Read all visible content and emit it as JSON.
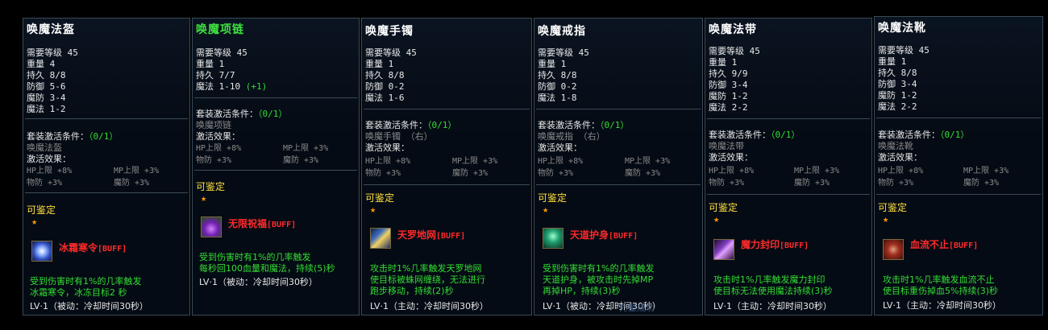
{
  "cards": [
    {
      "title": "唤魔法盔",
      "stats": [
        "需要等级 45",
        "重量 4",
        "持久 8/8",
        "防御 5-6",
        "魔防 3-4",
        "魔法 1-2"
      ],
      "set_label": "套装激活条件：",
      "set_count": "（0/1）",
      "set_item": "唤魔法盔",
      "set_item_suffix": "",
      "effect_label": "激活效果：",
      "eff_hp": "HP上限 +8%",
      "eff_mp": "MP上限 +3%",
      "eff_wf": "物防 +3%",
      "eff_mf": "魔防 +3%",
      "identify": "可鉴定",
      "skill_name": "冰霜寒令",
      "skill_tag": "[BUFF]",
      "desc": [
        "受到伤害时有1%的几率触发",
        "冰霜寒令，冰冻目标2 秒"
      ],
      "lv": "LV·1（被动：冷却时间30秒）",
      "icon": "ice-swirl-icon"
    },
    {
      "title": "唤魔项链",
      "stats": [
        "需要等级 45",
        "重量 1",
        "持久 7/7",
        "魔法 1-10"
      ],
      "stat_bonus": "(+1)",
      "set_label": "套装激活条件：",
      "set_count": "（0/1）",
      "set_item": "唤魔项链",
      "set_item_suffix": "",
      "effect_label": "激活效果：",
      "eff_hp": "HP上限 +8%",
      "eff_mp": "MP上限 +3%",
      "eff_wf": "物防 +3%",
      "eff_mf": "魔防 +3%",
      "identify": "可鉴定",
      "skill_name": "无限祝福",
      "skill_tag": "[BUFF]",
      "desc": [
        "受到伤害时有1%的几率触发",
        "每秒回100血量和魔法，持续(5)秒"
      ],
      "lv": "LV·1（被动：冷却时间30秒）",
      "icon": "potion-flask-icon"
    },
    {
      "title": "唤魔手镯",
      "stats": [
        "需要等级 45",
        "重量 1",
        "持久 8/8",
        "防御 0-2",
        "魔法 1-6"
      ],
      "set_label": "套装激活条件：",
      "set_count": "（0/1）",
      "set_item": "唤魔手镯",
      "set_item_suffix": "（右）",
      "effect_label": "激活效果：",
      "eff_hp": "HP上限 +8%",
      "eff_mp": "MP上限 +3%",
      "eff_wf": "物防 +3%",
      "eff_mf": "魔防 +3%",
      "identify": "可鉴定",
      "skill_name": "天罗地网",
      "skill_tag": "[BUFF]",
      "desc": [
        "攻击时1%几率触发天罗地网",
        "使目标被蛛网缠绕，无法进行",
        "跑步移动，持续(2)秒"
      ],
      "lv": "LV·1（主动：冷却时间30秒）",
      "icon": "net-trap-icon"
    },
    {
      "title": "唤魔戒指",
      "stats": [
        "需要等级 45",
        "重量 1",
        "持久 8/8",
        "防御 0-2",
        "魔法 1-8"
      ],
      "set_label": "套装激活条件：",
      "set_count": "（0/1）",
      "set_item": "唤魔戒指",
      "set_item_suffix": "（右）",
      "effect_label": "激活效果：",
      "eff_hp": "HP上限 +8%",
      "eff_mp": "MP上限 +3%",
      "eff_wf": "物防 +3%",
      "eff_mf": "魔防 +3%",
      "identify": "可鉴定",
      "skill_name": "天道护身",
      "skill_tag": "[BUFF]",
      "desc": [
        "受到伤害时有1%的几率触发",
        "天道护身，被攻击时先掉MP",
        "再掉HP，持续(3)秒"
      ],
      "lv": "LV·1（被动：冷却时间30秒）",
      "icon": "shield-aura-icon"
    },
    {
      "title": "唤魔法带",
      "stats": [
        "需要等级 45",
        "重量 1",
        "持久 9/9",
        "防御 3-4",
        "魔防 1-2",
        "魔法 2-2"
      ],
      "set_label": "套装激活条件：",
      "set_count": "（0/1）",
      "set_item": "唤魔法带",
      "set_item_suffix": "",
      "effect_label": "激活效果：",
      "eff_hp": "HP上限 +8%",
      "eff_mp": "MP上限 +3%",
      "eff_wf": "物防 +3%",
      "eff_mf": "魔防 +3%",
      "identify": "可鉴定",
      "skill_name": "魔力封印",
      "skill_tag": "[BUFF]",
      "desc": [
        "攻击时1%几率触发魔力封印",
        "使目标无法使用魔法持续(3)秒"
      ],
      "lv": "LV·1（主动：冷却时间30秒）",
      "icon": "seal-blade-icon"
    },
    {
      "title": "唤魔法靴",
      "stats": [
        "需要等级 45",
        "重量 1",
        "持久 8/8",
        "防御 3-4",
        "魔防 1-2",
        "魔法 2-2"
      ],
      "set_label": "套装激活条件：",
      "set_count": "（0/1）",
      "set_item": "唤魔法靴",
      "set_item_suffix": "",
      "effect_label": "激活效果：",
      "eff_hp": "HP上限 +8%",
      "eff_mp": "MP上限 +3%",
      "eff_wf": "物防 +3%",
      "eff_mf": "魔防 +3%",
      "identify": "可鉴定",
      "skill_name": "血流不止",
      "skill_tag": "[BUFF]",
      "desc": [
        "攻击时1%几率触发血流不止",
        "使目标重伤掉血5%持续(3)秒"
      ],
      "lv": "LV·1（主动：冷却时间30秒）",
      "icon": "bleed-swirl-icon"
    }
  ],
  "watermark": "力量成功",
  "colors": {
    "title": "#ffffff",
    "title_necklace": "#40e040",
    "skill_name": "#ff2a2a",
    "desc": "#33dd33",
    "identify": "#ffe040",
    "star": "#ff9a00",
    "muted": "#8a8a8a"
  }
}
